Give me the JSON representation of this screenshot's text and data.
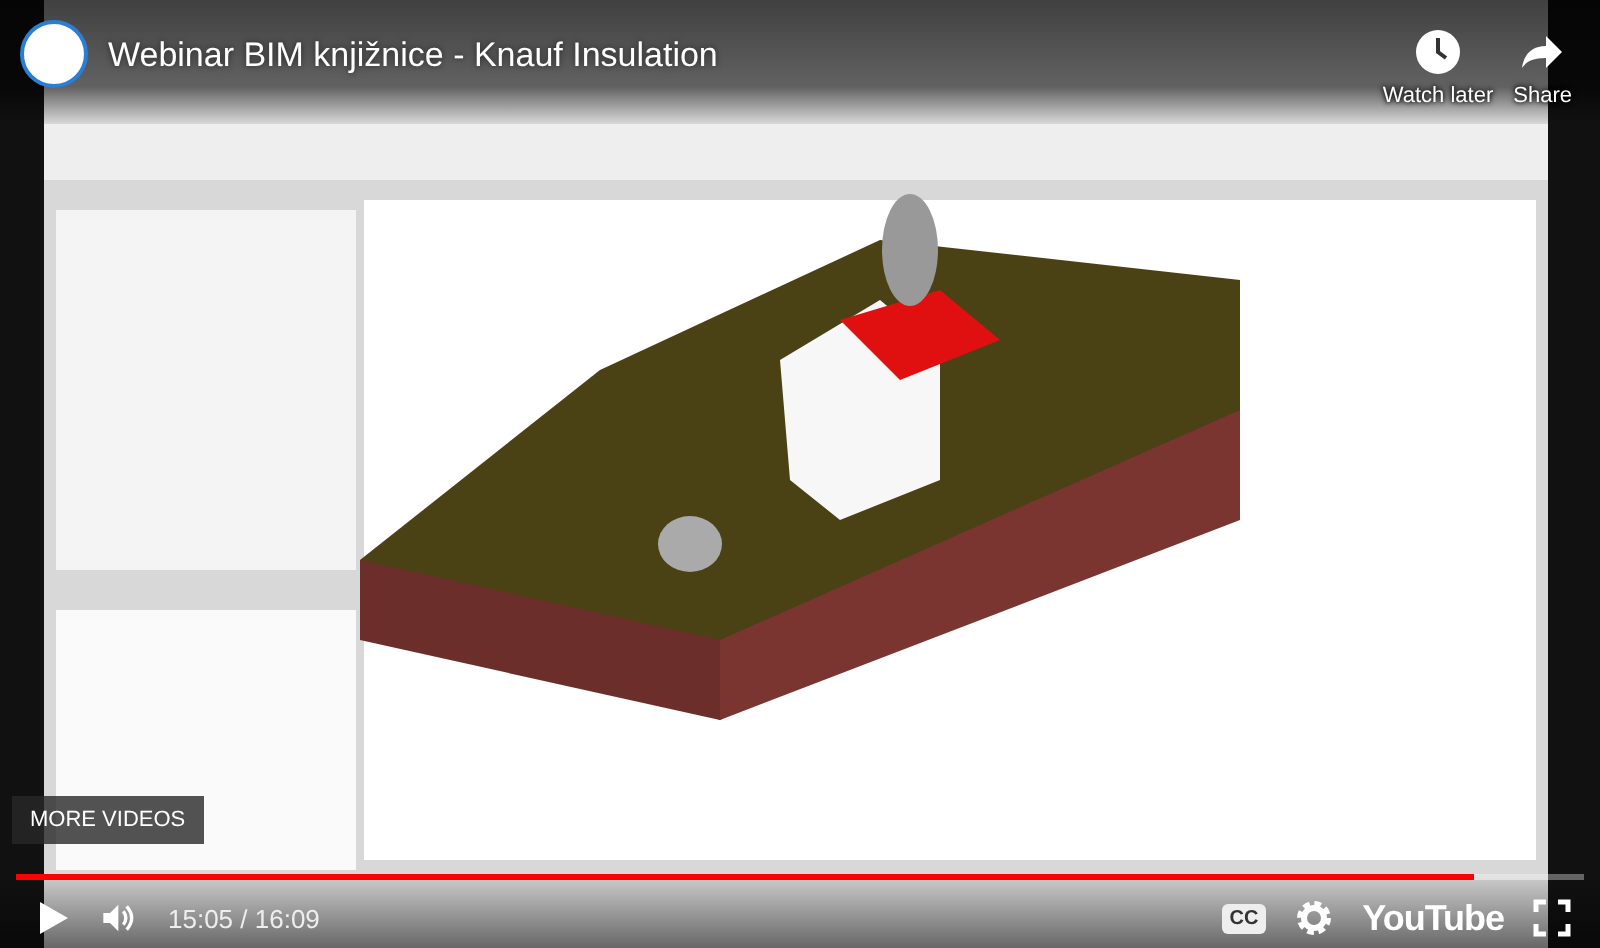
{
  "title": "Webinar BIM knjižnice - Knauf Insulation",
  "actions": [
    {
      "kind": "watch_later",
      "label": "Watch later"
    },
    {
      "kind": "share",
      "label": "Share"
    }
  ],
  "more_videos": "MORE VIDEOS",
  "progress": {
    "level": 0.93
  },
  "time": "15:05 / 16:09",
  "captions": "CC",
  "logo": "YouTube"
}
